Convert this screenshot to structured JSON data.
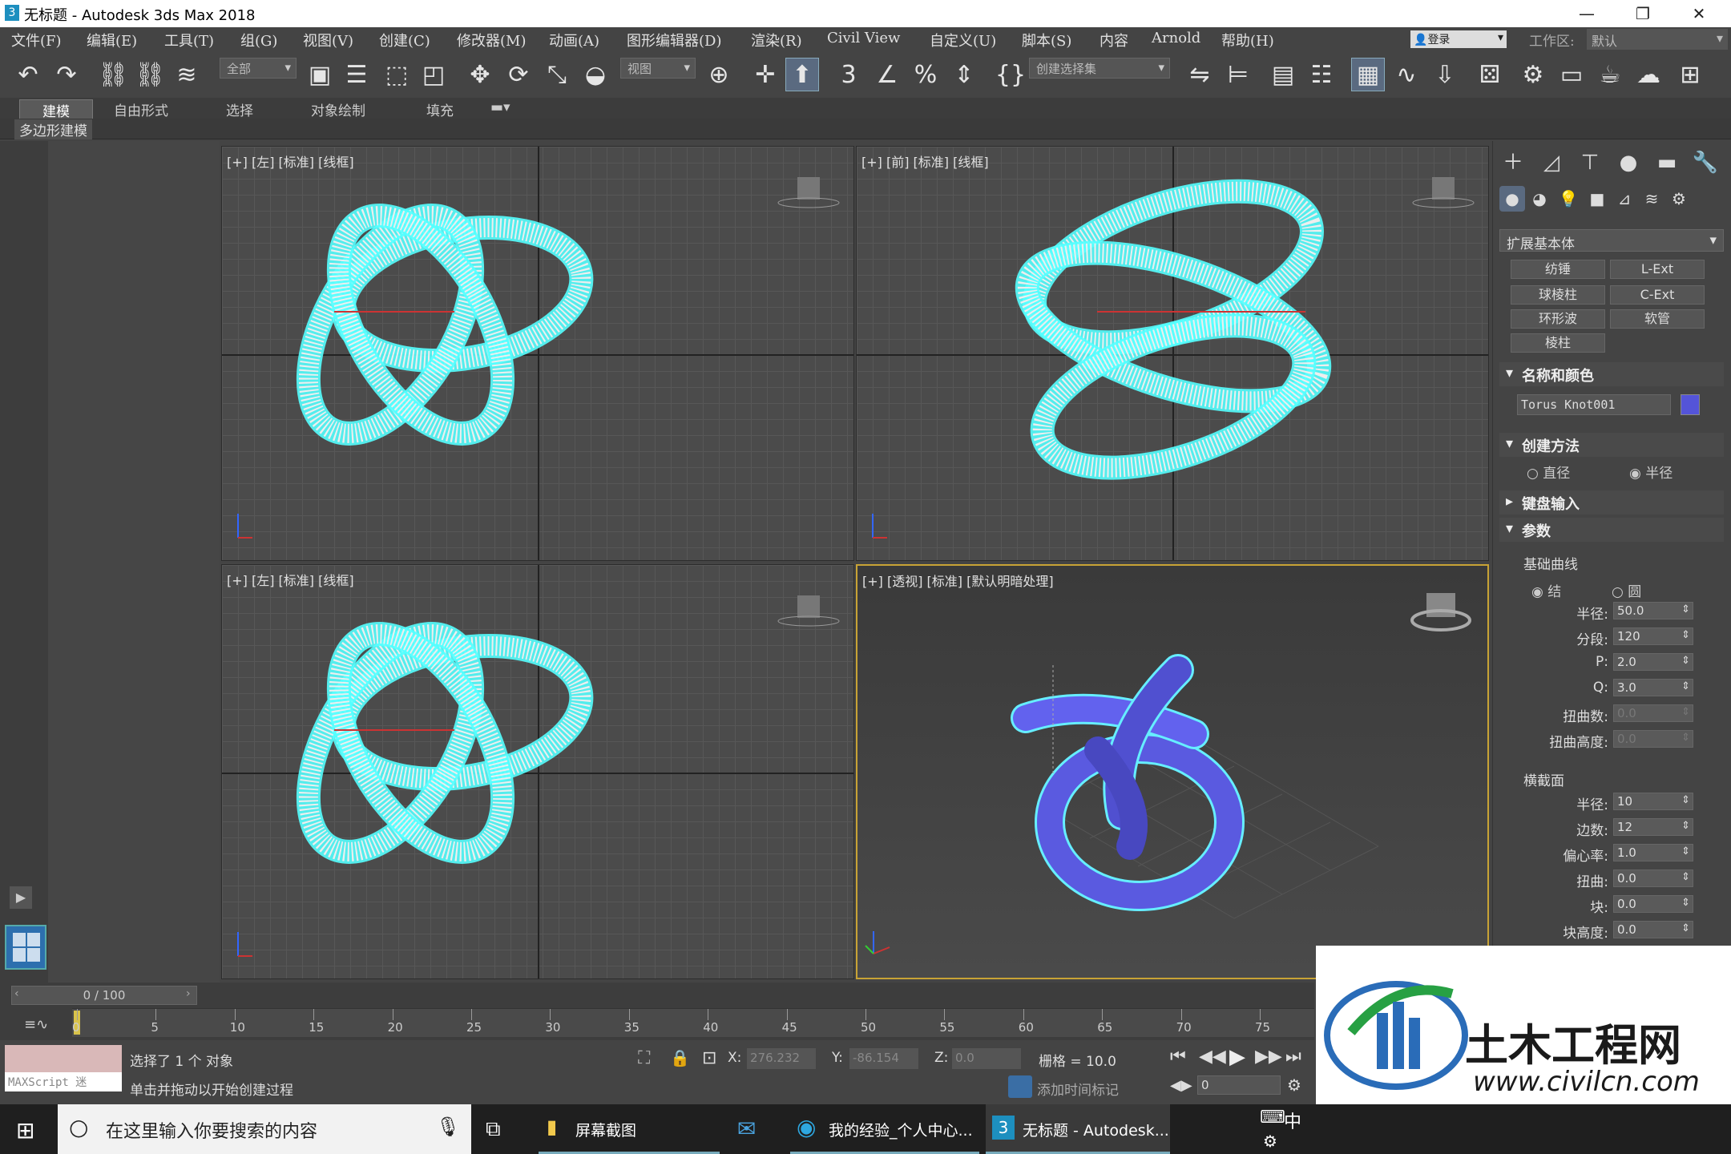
{
  "window": {
    "title": "无标题 - Autodesk 3ds Max 2018",
    "app_icon": "3",
    "minimize": "—",
    "maximize": "❐",
    "close": "✕"
  },
  "menu": [
    "文件(F)",
    "编辑(E)",
    "工具(T)",
    "组(G)",
    "视图(V)",
    "创建(C)",
    "修改器(M)",
    "动画(A)",
    "图形编辑器(D)",
    "渲染(R)",
    "Civil View",
    "自定义(U)",
    "脚本(S)",
    "内容",
    "Arnold",
    "帮助(H)"
  ],
  "account": {
    "login": "登录",
    "workspace_label": "工作区:",
    "workspace_value": "默认"
  },
  "toolbar": {
    "filter_value": "全部",
    "ref_coord": "视图",
    "named_sel": "创建选择集"
  },
  "ribbon": {
    "tabs": [
      "建模",
      "自由形式",
      "选择",
      "对象绘制",
      "填充"
    ],
    "sub": "多边形建模"
  },
  "viewports": [
    {
      "label": "[+] [左] [标准] [线框]"
    },
    {
      "label": "[+] [前] [标准] [线框]"
    },
    {
      "label": "[+] [左] [标准] [线框]"
    },
    {
      "label": "[+] [透视] [标准] [默认明暗处理]"
    }
  ],
  "axes": {
    "x": "x",
    "y": "y",
    "z": "z"
  },
  "command_panel": {
    "category": "扩展基本体",
    "object_buttons": [
      "纺锤",
      "L-Ext",
      "球棱柱",
      "C-Ext",
      "环形波",
      "软管",
      "棱柱"
    ],
    "name_color": {
      "title": "名称和颜色",
      "name": "Torus Knot001",
      "color": "#5454d8"
    },
    "creation": {
      "title": "创建方法",
      "opt1": "直径",
      "opt2": "半径"
    },
    "keyboard": {
      "title": "键盘输入"
    },
    "params": {
      "title": "参数",
      "base_curve": "基础曲线",
      "knot": "结",
      "circle": "圆",
      "rows": [
        {
          "label": "半径:",
          "value": "50.0"
        },
        {
          "label": "分段:",
          "value": "120"
        },
        {
          "label": "P:",
          "value": "2.0"
        },
        {
          "label": "Q:",
          "value": "3.0"
        },
        {
          "label": "扭曲数:",
          "value": "0.0"
        },
        {
          "label": "扭曲高度:",
          "value": "0.0"
        }
      ],
      "cross": "横截面",
      "cross_rows": [
        {
          "label": "半径:",
          "value": "10"
        },
        {
          "label": "边数:",
          "value": "12"
        },
        {
          "label": "偏心率:",
          "value": "1.0"
        },
        {
          "label": "扭曲:",
          "value": "0.0"
        },
        {
          "label": "块:",
          "value": "0.0"
        },
        {
          "label": "块高度:",
          "value": "0.0"
        }
      ]
    }
  },
  "timeline": {
    "frame": "0 / 100",
    "ticks": [
      "0",
      "5",
      "10",
      "15",
      "20",
      "25",
      "30",
      "35",
      "40",
      "45",
      "50",
      "55",
      "60",
      "65",
      "70",
      "75"
    ]
  },
  "status": {
    "maxscript": "MAXScript 迷",
    "selected": "选择了 1 个 对象",
    "hint": "单击并拖动以开始创建过程",
    "x_label": "X:",
    "x_value": "276.232",
    "y_label": "Y:",
    "y_value": "-86.154",
    "z_label": "Z:",
    "z_value": "0.0",
    "grid": "栅格 = 10.0",
    "add_time_tag": "添加时间标记",
    "frame_input": "0"
  },
  "taskbar": {
    "search": "在这里输入你要搜索的内容",
    "items": [
      "屏幕截图",
      "我的经验_个人中心...",
      "无标题 - Autodesk..."
    ],
    "ime": "中"
  },
  "watermark": {
    "brand": "土木工程网",
    "url": "www.civilcn.com"
  }
}
